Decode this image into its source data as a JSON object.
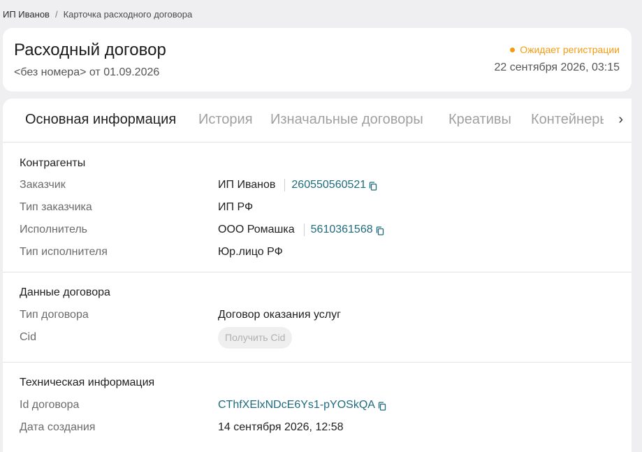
{
  "breadcrumb": {
    "root": "ИП Иванов",
    "separator": "/",
    "current": "Карточка расходного договора"
  },
  "header": {
    "title": "Расходный договор",
    "subtitle": "<без номера> от 01.09.2026",
    "status": "Ожидает регистрации",
    "status_color": "#f39c12",
    "datetime": "22 сентября 2026, 03:15"
  },
  "tabs": [
    {
      "label": "Основная информация",
      "active": true
    },
    {
      "label": "История",
      "active": false
    },
    {
      "label": "Изначальные договоры",
      "active": false
    },
    {
      "label": "Креативы",
      "active": false
    },
    {
      "label": "Контейнеры",
      "active": false
    }
  ],
  "tabs_arrow": "›",
  "counterparties": {
    "title": "Контрагенты",
    "customer_label": "Заказчик",
    "customer_name": "ИП Иванов",
    "customer_inn": "260550560521",
    "customer_type_label": "Тип заказчика",
    "customer_type": "ИП РФ",
    "executor_label": "Исполнитель",
    "executor_name": "ООО Ромашка",
    "executor_inn": "5610361568",
    "executor_type_label": "Тип исполнителя",
    "executor_type": "Юр.лицо РФ"
  },
  "contract_data": {
    "title": "Данные договора",
    "type_label": "Тип договора",
    "type_value": "Договор оказания услуг",
    "cid_label": "Cid",
    "cid_button": "Получить Cid"
  },
  "tech_info": {
    "title": "Техническая информация",
    "id_label": "Id договора",
    "id_value": "CThfXElxNDcE6Ys1-pYOSkQA",
    "created_label": "Дата создания",
    "created_value": "14 сентября 2026, 12:58"
  },
  "colors": {
    "link": "#1e6b7d",
    "background": "#efeff1"
  }
}
